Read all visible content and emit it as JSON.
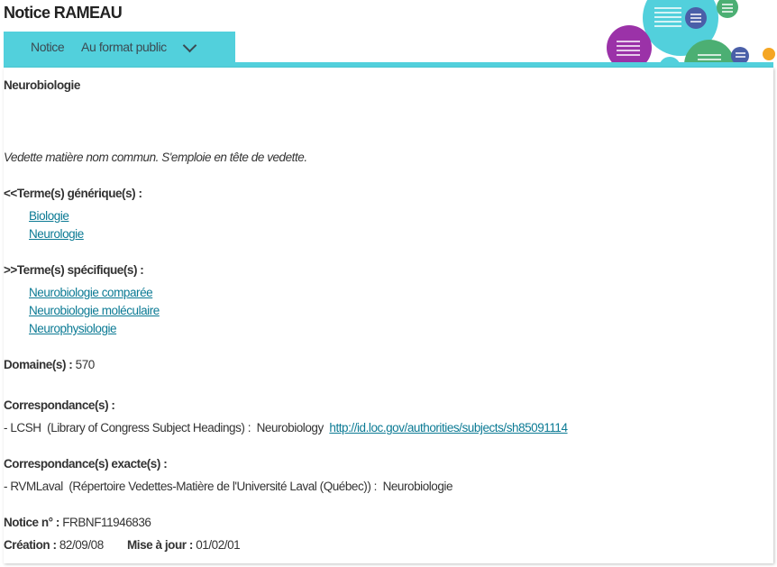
{
  "header": {
    "title": "Notice RAMEAU"
  },
  "tabs": {
    "notice": "Notice",
    "format": "Au format public"
  },
  "colors": {
    "accent": "#52d0dc",
    "link": "#0b7a94",
    "purple": "#9b32a8",
    "green": "#4caf73",
    "blue": "#4a5fa8",
    "orange": "#f5a623"
  },
  "record": {
    "heading": "Neurobiologie",
    "note": "Vedette matière nom commun. S'emploie en tête de vedette.",
    "generic_label": "<<Terme(s) générique(s) :",
    "generic": [
      "Biologie",
      "Neurologie"
    ],
    "specific_label": ">>Terme(s) spécifique(s) :",
    "specific": [
      "Neurobiologie comparée",
      "Neurobiologie moléculaire",
      "Neurophysiologie"
    ],
    "domain_label": "Domaine(s) :",
    "domain": "570",
    "corr_label": "Correspondance(s) :",
    "corr_text": "- LCSH  (Library of Congress Subject Headings) :  Neurobiology",
    "corr_link": "http://id.loc.gov/authorities/subjects/sh85091114",
    "exact_label": "Correspondance(s) exacte(s) :",
    "exact_text": "- RVMLaval  (Répertoire Vedettes-Matière de l'Université Laval (Québec)) :  Neurobiologie",
    "notice_label": "Notice n° :",
    "notice": "FRBNF11946836",
    "creation_label": "Création :",
    "creation": "82/09/08",
    "update_label": "Mise à jour :",
    "update": "01/02/01"
  }
}
